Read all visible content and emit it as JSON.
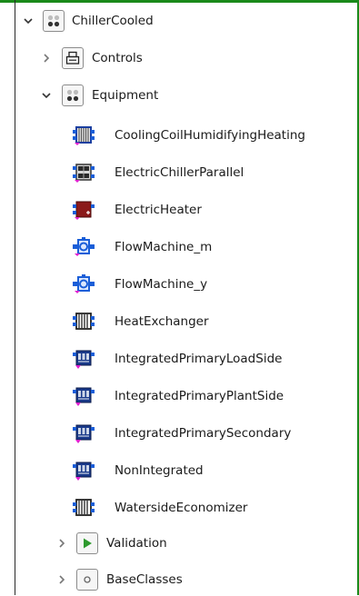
{
  "tree": {
    "root": {
      "label": "ChillerCooled"
    },
    "controls": {
      "label": "Controls"
    },
    "equipment": {
      "label": "Equipment",
      "items": [
        {
          "label": "CoolingCoilHumidifyingHeating",
          "icon": "cooling-coil-icon"
        },
        {
          "label": "ElectricChillerParallel",
          "icon": "chiller-parallel-icon"
        },
        {
          "label": "ElectricHeater",
          "icon": "electric-heater-icon"
        },
        {
          "label": "FlowMachine_m",
          "icon": "flow-machine-icon"
        },
        {
          "label": "FlowMachine_y",
          "icon": "flow-machine-icon"
        },
        {
          "label": "HeatExchanger",
          "icon": "heat-exchanger-icon"
        },
        {
          "label": "IntegratedPrimaryLoadSide",
          "icon": "integrated-plant-icon"
        },
        {
          "label": "IntegratedPrimaryPlantSide",
          "icon": "integrated-plant-icon"
        },
        {
          "label": "IntegratedPrimarySecondary",
          "icon": "integrated-plant-icon"
        },
        {
          "label": "NonIntegrated",
          "icon": "integrated-plant-icon"
        },
        {
          "label": "WatersideEconomizer",
          "icon": "heat-exchanger-icon"
        }
      ]
    },
    "validation": {
      "label": "Validation"
    },
    "baseclasses": {
      "label": "BaseClasses"
    }
  },
  "colors": {
    "frame_green": "#1a8a1a",
    "play_green": "#2e9a2e",
    "model_blue": "#1a5ed8",
    "heater_red": "#8b1a1a",
    "connector_magenta": "#e020d0"
  }
}
